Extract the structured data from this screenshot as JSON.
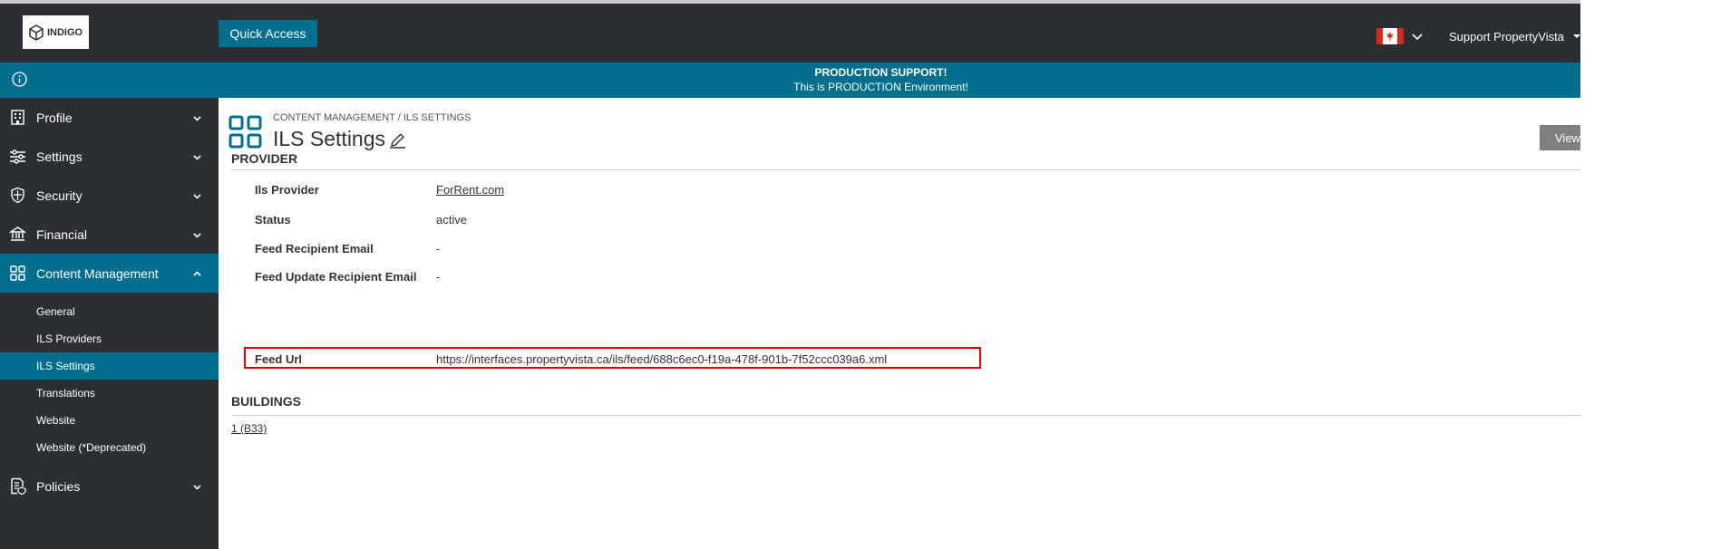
{
  "header": {
    "logo_text": "INDIGO",
    "quick_access_label": "Quick Access",
    "user_name": "Support PropertyVista"
  },
  "banner": {
    "title": "PRODUCTION SUPPORT!",
    "subtitle": "This is PRODUCTION Environment!"
  },
  "sidebar": {
    "items": [
      {
        "label": "Profile",
        "icon": "building-icon"
      },
      {
        "label": "Settings",
        "icon": "sliders-icon"
      },
      {
        "label": "Security",
        "icon": "shield-icon"
      },
      {
        "label": "Financial",
        "icon": "bank-icon"
      },
      {
        "label": "Content Management",
        "icon": "grid-icon"
      },
      {
        "label": "Policies",
        "icon": "policy-doc-icon"
      }
    ],
    "subitems": [
      "General",
      "ILS Providers",
      "ILS Settings",
      "Translations",
      "Website",
      "Website (*Deprecated)"
    ],
    "active_subitem": "ILS Settings"
  },
  "page": {
    "breadcrumb": "CONTENT MANAGEMENT / ILS SETTINGS",
    "title": "ILS Settings",
    "view_button_label": "View"
  },
  "provider": {
    "section_title": "PROVIDER",
    "fields": [
      {
        "label": "Ils Provider",
        "value": "ForRent.com"
      },
      {
        "label": "Status",
        "value": "active"
      },
      {
        "label": "Feed Recipient Email",
        "value": "-"
      },
      {
        "label": "Feed Update Recipient Email",
        "value": "-"
      },
      {
        "label": "Feed Url",
        "value": "https://interfaces.propertyvista.ca/ils/feed/688c6ec0-f19a-478f-901b-7f52ccc039a6.xml"
      }
    ]
  },
  "buildings": {
    "section_title": "BUILDINGS",
    "items": [
      "1 (B33)"
    ]
  },
  "colors": {
    "accent": "#006e8c",
    "dark": "#2b2f33",
    "highlight": "#e00000"
  }
}
